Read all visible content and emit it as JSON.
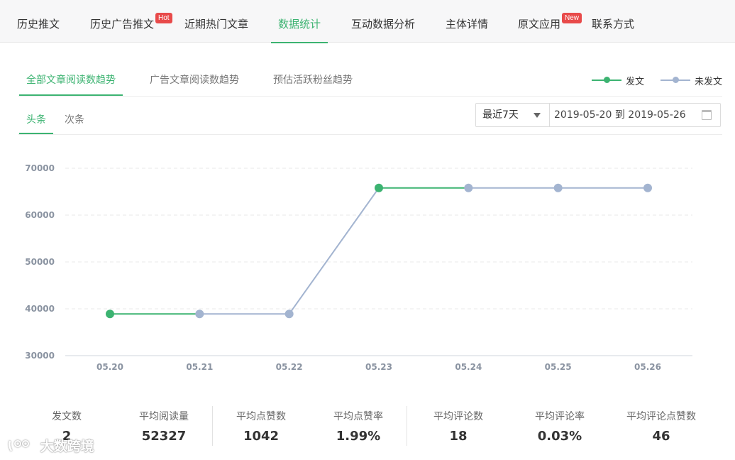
{
  "nav": {
    "items": [
      {
        "label": "历史推文"
      },
      {
        "label": "历史广告推文",
        "badge": "Hot"
      },
      {
        "label": "近期热门文章"
      },
      {
        "label": "数据统计",
        "active": true
      },
      {
        "label": "互动数据分析"
      },
      {
        "label": "主体详情"
      },
      {
        "label": "原文应用",
        "badge": "New"
      },
      {
        "label": "联系方式"
      }
    ]
  },
  "subtabs": [
    {
      "label": "全部文章阅读数趋势",
      "active": true
    },
    {
      "label": "广告文章阅读数趋势"
    },
    {
      "label": "预估活跃粉丝趋势"
    }
  ],
  "legend": [
    {
      "label": "发文",
      "color": "#3cb371"
    },
    {
      "label": "未发文",
      "color": "#a3b4d0"
    }
  ],
  "minitabs": [
    {
      "label": "头条",
      "active": true
    },
    {
      "label": "次条"
    }
  ],
  "range": {
    "selected": "最近7天",
    "start": "2019-05-20",
    "sep": "到",
    "end": "2019-05-26"
  },
  "chart_data": {
    "type": "line",
    "categories": [
      "05.20",
      "05.21",
      "05.22",
      "05.23",
      "05.24",
      "05.25",
      "05.26"
    ],
    "values": [
      38900,
      38900,
      38900,
      65800,
      65800,
      65800,
      65800
    ],
    "published": [
      true,
      false,
      false,
      true,
      false,
      false,
      false
    ],
    "ylim": [
      30000,
      70000
    ],
    "yticks": [
      30000,
      40000,
      50000,
      60000,
      70000
    ],
    "grid": true,
    "colors": {
      "published": "#3cb371",
      "unpublished": "#a3b4d0"
    }
  },
  "stats": [
    {
      "label": "发文数",
      "value": "2"
    },
    {
      "label": "平均阅读量",
      "value": "52327"
    },
    {
      "label": "平均点赞数",
      "value": "1042"
    },
    {
      "label": "平均点赞率",
      "value": "1.99%"
    },
    {
      "label": "平均评论数",
      "value": "18"
    },
    {
      "label": "平均评论率",
      "value": "0.03%"
    },
    {
      "label": "平均评论点赞数",
      "value": "46"
    }
  ],
  "watermark": {
    "text": "大数跨境"
  }
}
